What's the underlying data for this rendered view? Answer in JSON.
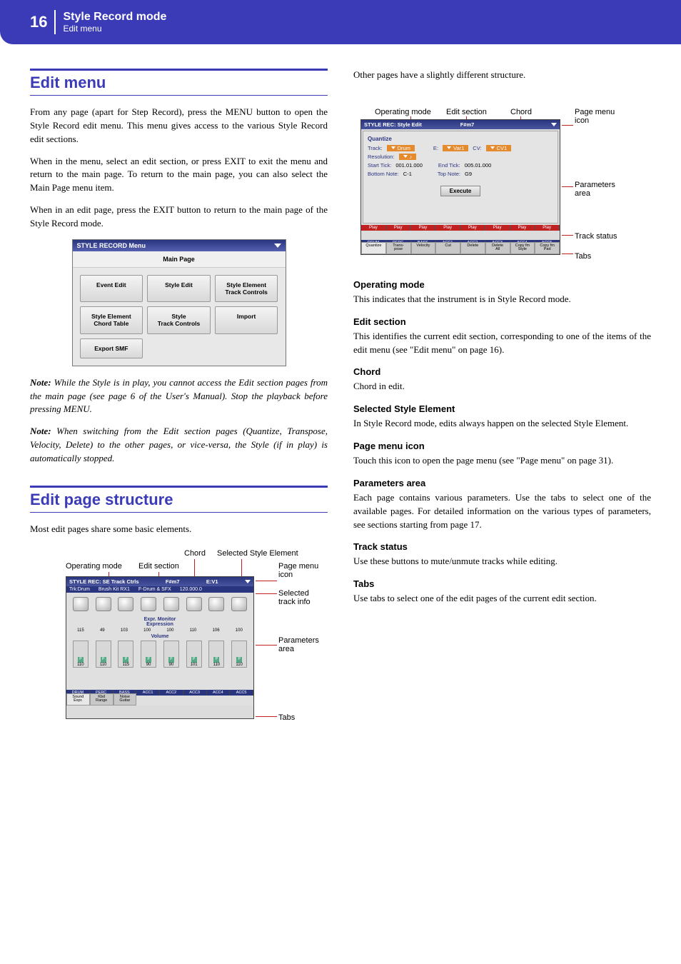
{
  "header": {
    "page": "16",
    "main": "Style Record mode",
    "sub": "Edit menu"
  },
  "left": {
    "title1": "Edit menu",
    "p1": "From any page (apart for Step Record), press the MENU button to open the Style Record edit menu. This menu gives access to the various Style Record edit sections.",
    "p2": "When in the menu, select an edit section, or press EXIT to exit the menu and return to the main page. To return to the main page, you can also select the Main Page menu item.",
    "p3": "When in an edit page, press the EXIT button to return to the main page of the Style Record mode.",
    "menu": {
      "title": "STYLE RECORD Menu",
      "main": "Main Page",
      "b1": "Event Edit",
      "b2": "Style Edit",
      "b3": "Style Element\nTrack Controls",
      "b4": "Style Element\nChord Table",
      "b5": "Style\nTrack Controls",
      "b6": "Import",
      "b7": "Export SMF"
    },
    "note1pre": "Note:",
    "note1": " While the Style is in play, you cannot access the Edit section pages from the main page (see page 6 of the User's Manual). Stop the playback before pressing MENU.",
    "note2pre": "Note:",
    "note2": " When switching from the Edit section pages (Quantize, Transpose, Velocity, Delete) to the other pages, or vice-versa, the Style (if in play) is automatically stopped.",
    "title2": "Edit page structure",
    "p4": "Most edit pages share some basic elements.",
    "anno1": {
      "opmode": "Operating mode",
      "editsec": "Edit section",
      "chord": "Chord",
      "sse": "Selected Style Element",
      "pmicon": "Page menu icon",
      "selinfo": "Selected track info",
      "params": "Parameters area",
      "tabs": "Tabs",
      "ss_title_l": "STYLE REC: SE Track Ctrls",
      "ss_title_m": "F#m7",
      "ss_title_r": "E:V1",
      "ss_sub1": "Trk:Drum",
      "ss_sub2": "Brush Kit RX1",
      "ss_sub3": "F-Drum & SFX",
      "ss_sub4": "120.000.0",
      "expr": "Expr. Monitor\nExpression",
      "vol": "Volume",
      "nums": [
        "115",
        "49",
        "103",
        "100",
        "100",
        "110",
        "106",
        "100"
      ],
      "snums": [
        "110",
        "110",
        "115",
        "90",
        "90",
        "101",
        "110",
        "110"
      ],
      "trk": [
        "DRUM",
        "PERC",
        "BASS",
        "ACC1",
        "ACC2",
        "ACC3",
        "ACC4",
        "ACC5"
      ],
      "tabs_b": [
        "Sound\nExpr.",
        "Kbd\nRange",
        "Noise\nGuitar"
      ]
    }
  },
  "right": {
    "intro": "Other pages have a slightly different structure.",
    "anno2": {
      "opmode": "Operating mode",
      "editsec": "Edit section",
      "chord": "Chord",
      "pmicon": "Page menu icon",
      "params": "Parameters area",
      "trkstat": "Track status",
      "tabs": "Tabs",
      "ss_title_l": "STYLE REC: Style Edit",
      "ss_title_m": "F#m7",
      "qtitle": "Quantize",
      "qtrack": "Track:",
      "qtrack_v": "Drum",
      "qe": "E:",
      "qe_v": "Var1",
      "qcv": "CV:",
      "qcv_v": "CV1",
      "qres": "Resolution:",
      "qres_v": "♪",
      "qstl": "Start Tick:",
      "qst_v": "001.01.000",
      "qetl": "End Tick:",
      "qet_v": "005.01.000",
      "qbnl": "Bottom Note:",
      "qbn_v": "C-1",
      "qtnl": "Top Note:",
      "qtn_v": "G9",
      "exec": "Execute",
      "play": "Play",
      "trk": [
        "DRUM",
        "PERC",
        "BASS",
        "ACC1",
        "ACC2",
        "ACC3",
        "ACC4",
        "ACC5"
      ],
      "tabs_b": [
        "Quantize",
        "Trans-\npose",
        "Velocity",
        "Cut",
        "Delete",
        "Delete\nAll",
        "Copy fm\nStyle",
        "Copy fm\nPad"
      ]
    },
    "s1": "Operating mode",
    "s1t": "This indicates that the instrument is in Style Record mode.",
    "s2": "Edit section",
    "s2t": "This identifies the current edit section, corresponding to one of the items of the edit menu (see \"Edit menu\" on page 16).",
    "s3": "Chord",
    "s3t": "Chord in edit.",
    "s4": "Selected Style Element",
    "s4t": "In Style Record mode, edits always happen on the selected Style Element.",
    "s5": "Page menu icon",
    "s5t": "Touch this icon to open the page menu (see \"Page menu\" on page 31).",
    "s6": "Parameters area",
    "s6t": "Each page contains various parameters. Use the tabs to select one of the available pages. For detailed information on the various types of parameters, see sections starting from page 17.",
    "s7": "Track status",
    "s7t": "Use these buttons to mute/unmute tracks while editing.",
    "s8": "Tabs",
    "s8t": "Use tabs to select one of the edit pages of the current edit section."
  }
}
